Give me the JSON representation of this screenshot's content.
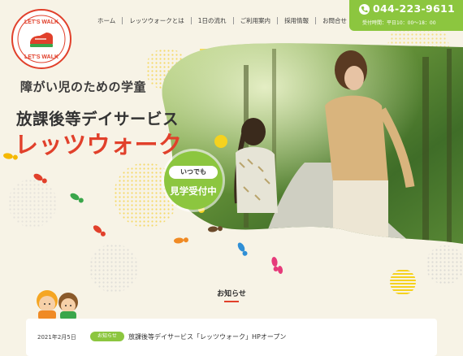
{
  "logo": {
    "top_text": "LET'S WALK",
    "bottom_text": "LET'S WALK"
  },
  "nav": [
    "ホーム",
    "レッツウォークとは",
    "1日の流れ",
    "ご利用案内",
    "採用情報",
    "お問合せ"
  ],
  "contact": {
    "phone": "044-223-9611",
    "hours": "受付時間：平日10：00～18：00"
  },
  "hero": {
    "subtitle": "障がい児のための学童",
    "title": "放課後等デイサービス",
    "brand": "レッツウォーク",
    "visit_badge": {
      "small": "いつでも",
      "main": "見学受付中"
    }
  },
  "news": {
    "heading": "お知らせ",
    "items": [
      {
        "date": "2021年2月5日",
        "tag": "お知らせ",
        "title": "放課後等デイサービス「レッツウォーク」HPオープン"
      }
    ]
  },
  "colors": {
    "accent_green": "#8cc63f",
    "brand_red": "#e1402b",
    "background": "#f7f3e6",
    "accent_yellow": "#f5d21e"
  }
}
